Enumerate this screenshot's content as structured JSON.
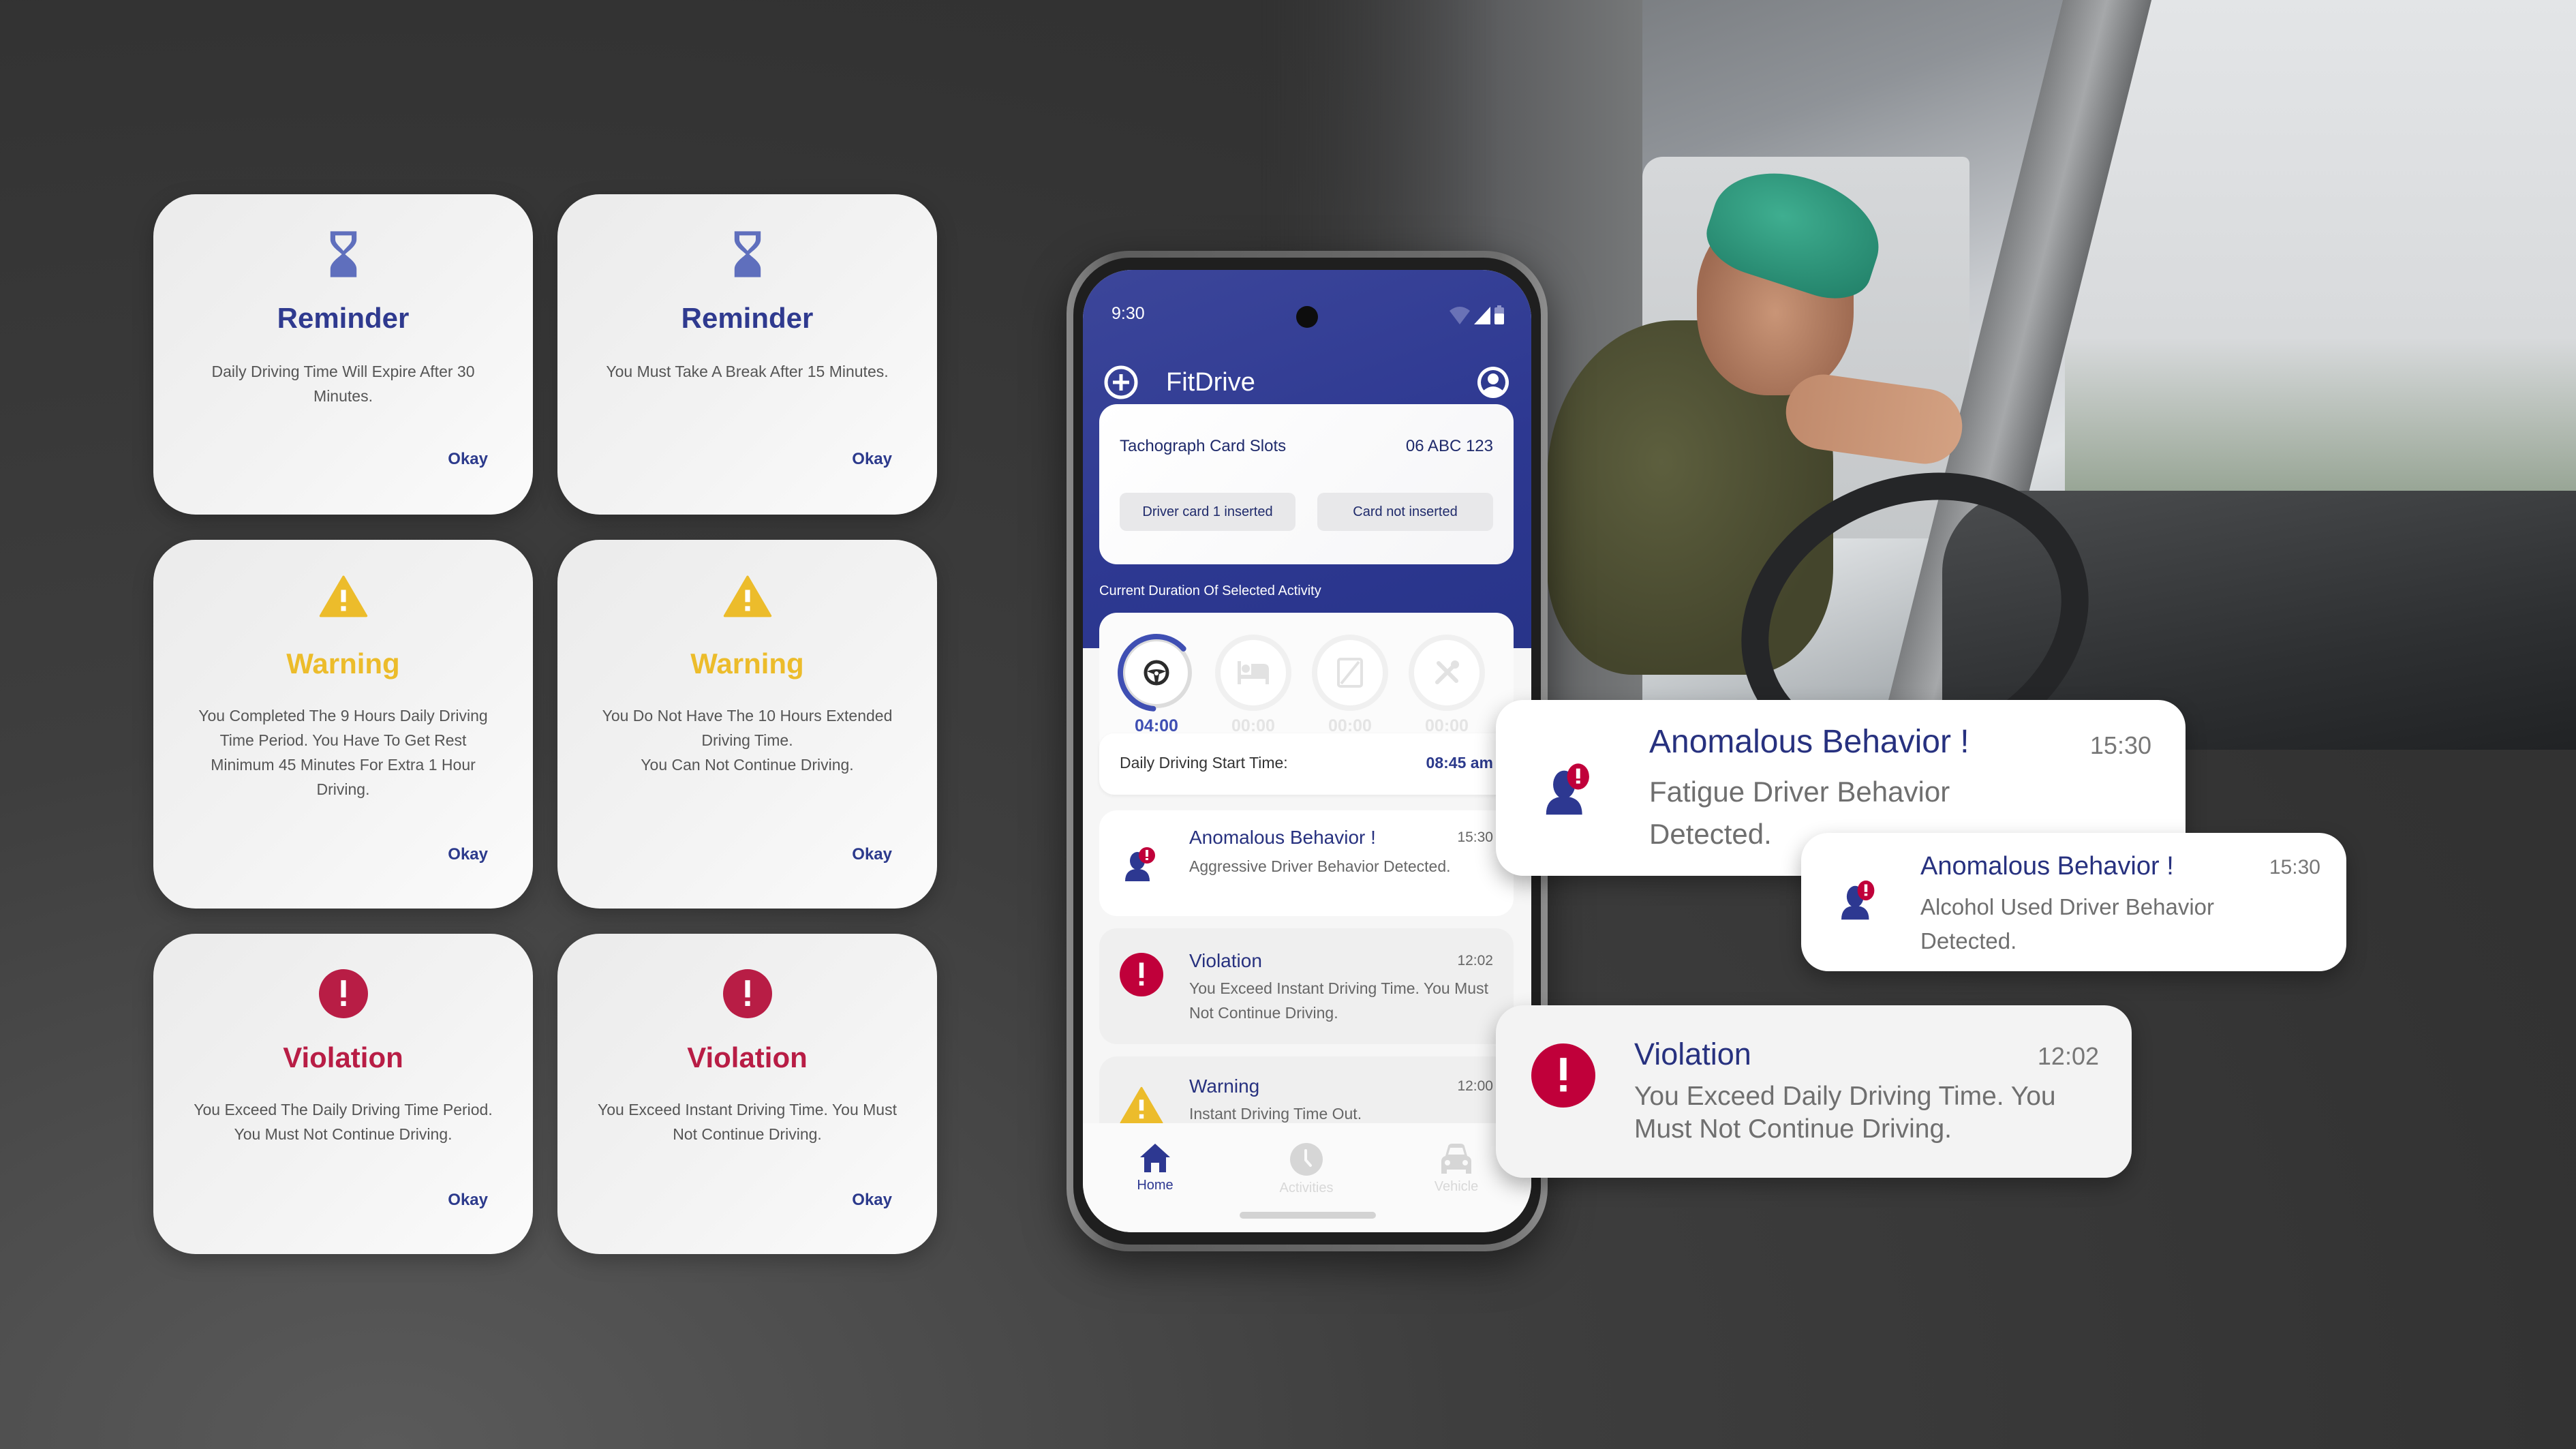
{
  "colors": {
    "brand": "#2f3a8f",
    "reminder": "#5f6fbd",
    "warning": "#ecbc2b",
    "violation": "#b81d45",
    "violation_icon": "#c0003a"
  },
  "alert_cards": [
    {
      "type": "reminder",
      "icon": "hourglass-icon",
      "title": "Reminder",
      "body": "Daily Driving Time Will Expire After 30 Minutes.",
      "action": "Okay"
    },
    {
      "type": "reminder",
      "icon": "hourglass-icon",
      "title": "Reminder",
      "body": "You Must Take A Break After 15 Minutes.",
      "action": "Okay"
    },
    {
      "type": "warning",
      "icon": "warning-triangle-icon",
      "title": "Warning",
      "body": "You Completed The 9 Hours Daily Driving Time Period. You Have To Get Rest Minimum 45 Minutes For Extra 1 Hour Driving.",
      "action": "Okay"
    },
    {
      "type": "warning",
      "icon": "warning-triangle-icon",
      "title": "Warning",
      "body_lines": [
        "You Do Not Have The 10 Hours Extended Driving Time.",
        "You Can Not Continue Driving."
      ],
      "action": "Okay"
    },
    {
      "type": "violation",
      "icon": "exclamation-circle-icon",
      "title": "Violation",
      "body": "You Exceed The Daily Driving Time Period. You Must Not Continue Driving.",
      "action": "Okay"
    },
    {
      "type": "violation",
      "icon": "exclamation-circle-icon",
      "title": "Violation",
      "body": "You Exceed Instant Driving Time. You Must Not Continue Driving.",
      "action": "Okay"
    }
  ],
  "phone": {
    "status_bar": {
      "time": "9:30"
    },
    "app_bar": {
      "title": "FitDrive",
      "left_icon": "add-circle-icon",
      "right_icon": "account-circle-icon"
    },
    "tachograph": {
      "label": "Tachograph Card Slots",
      "plate": "06 ABC 123",
      "slots": [
        "Driver card 1 inserted",
        "Card not inserted"
      ]
    },
    "duration_label": "Current Duration Of Selected Activity",
    "activities": [
      {
        "name": "driving",
        "icon": "steering-wheel-icon",
        "value": "04:00",
        "active": true,
        "progress": 0.62
      },
      {
        "name": "rest",
        "icon": "bed-icon",
        "value": "00:00",
        "active": false
      },
      {
        "name": "availability",
        "icon": "availability-icon",
        "value": "00:00",
        "active": false
      },
      {
        "name": "work",
        "icon": "tools-icon",
        "value": "00:00",
        "active": false
      }
    ],
    "daily_start": {
      "label": "Daily Driving Start Time:",
      "value": "08:45 am"
    },
    "feed": [
      {
        "type": "anomaly",
        "icon": "driver-alert-icon",
        "title": "Anomalous Behavior !",
        "time": "15:30",
        "body": "Aggressive Driver Behavior Detected."
      },
      {
        "type": "violation",
        "icon": "exclamation-circle-icon",
        "title": "Violation",
        "time": "12:02",
        "body": "You Exceed Instant Driving Time. You Must Not Continue Driving."
      },
      {
        "type": "warning",
        "icon": "warning-triangle-icon",
        "title": "Warning",
        "time": "12:00",
        "body": "Instant Driving Time Out."
      }
    ],
    "bottom_nav": [
      {
        "label": "Home",
        "icon": "home-icon",
        "active": true
      },
      {
        "label": "Activities",
        "icon": "clock-icon",
        "active": false
      },
      {
        "label": "Vehicle",
        "icon": "car-icon",
        "active": false
      }
    ]
  },
  "notifications": [
    {
      "type": "anomaly",
      "icon": "driver-alert-icon",
      "title": "Anomalous Behavior !",
      "time": "15:30",
      "body": "Fatigue Driver Behavior Detected."
    },
    {
      "type": "anomaly",
      "icon": "driver-alert-icon",
      "title": "Anomalous Behavior !",
      "time": "15:30",
      "body": "Alcohol Used Driver Behavior Detected."
    },
    {
      "type": "violation",
      "icon": "exclamation-circle-icon",
      "title": "Violation",
      "time": "12:02",
      "body": "You Exceed Daily Driving Time. You Must Not Continue Driving."
    }
  ]
}
